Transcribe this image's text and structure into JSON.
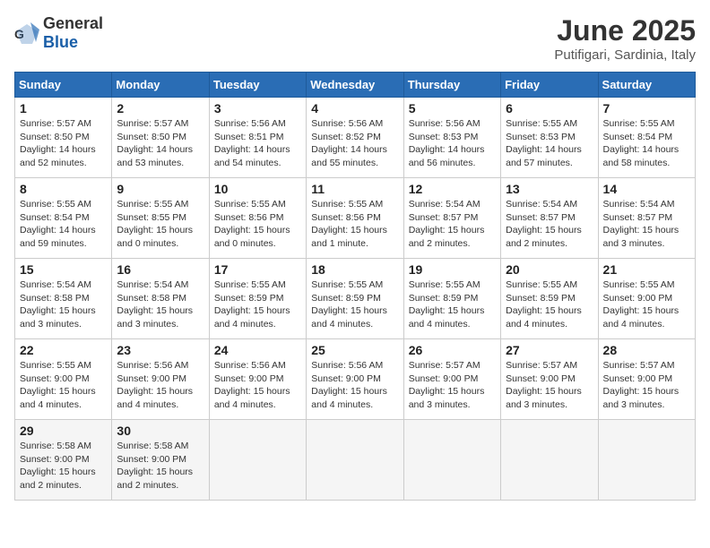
{
  "header": {
    "logo_general": "General",
    "logo_blue": "Blue",
    "month": "June 2025",
    "location": "Putifigari, Sardinia, Italy"
  },
  "days_of_week": [
    "Sunday",
    "Monday",
    "Tuesday",
    "Wednesday",
    "Thursday",
    "Friday",
    "Saturday"
  ],
  "weeks": [
    [
      {
        "day": "1",
        "sunrise": "5:57 AM",
        "sunset": "8:50 PM",
        "daylight": "14 hours and 52 minutes."
      },
      {
        "day": "2",
        "sunrise": "5:57 AM",
        "sunset": "8:50 PM",
        "daylight": "14 hours and 53 minutes."
      },
      {
        "day": "3",
        "sunrise": "5:56 AM",
        "sunset": "8:51 PM",
        "daylight": "14 hours and 54 minutes."
      },
      {
        "day": "4",
        "sunrise": "5:56 AM",
        "sunset": "8:52 PM",
        "daylight": "14 hours and 55 minutes."
      },
      {
        "day": "5",
        "sunrise": "5:56 AM",
        "sunset": "8:53 PM",
        "daylight": "14 hours and 56 minutes."
      },
      {
        "day": "6",
        "sunrise": "5:55 AM",
        "sunset": "8:53 PM",
        "daylight": "14 hours and 57 minutes."
      },
      {
        "day": "7",
        "sunrise": "5:55 AM",
        "sunset": "8:54 PM",
        "daylight": "14 hours and 58 minutes."
      }
    ],
    [
      {
        "day": "8",
        "sunrise": "5:55 AM",
        "sunset": "8:54 PM",
        "daylight": "14 hours and 59 minutes."
      },
      {
        "day": "9",
        "sunrise": "5:55 AM",
        "sunset": "8:55 PM",
        "daylight": "15 hours and 0 minutes."
      },
      {
        "day": "10",
        "sunrise": "5:55 AM",
        "sunset": "8:56 PM",
        "daylight": "15 hours and 0 minutes."
      },
      {
        "day": "11",
        "sunrise": "5:55 AM",
        "sunset": "8:56 PM",
        "daylight": "15 hours and 1 minute."
      },
      {
        "day": "12",
        "sunrise": "5:54 AM",
        "sunset": "8:57 PM",
        "daylight": "15 hours and 2 minutes."
      },
      {
        "day": "13",
        "sunrise": "5:54 AM",
        "sunset": "8:57 PM",
        "daylight": "15 hours and 2 minutes."
      },
      {
        "day": "14",
        "sunrise": "5:54 AM",
        "sunset": "8:57 PM",
        "daylight": "15 hours and 3 minutes."
      }
    ],
    [
      {
        "day": "15",
        "sunrise": "5:54 AM",
        "sunset": "8:58 PM",
        "daylight": "15 hours and 3 minutes."
      },
      {
        "day": "16",
        "sunrise": "5:54 AM",
        "sunset": "8:58 PM",
        "daylight": "15 hours and 3 minutes."
      },
      {
        "day": "17",
        "sunrise": "5:55 AM",
        "sunset": "8:59 PM",
        "daylight": "15 hours and 4 minutes."
      },
      {
        "day": "18",
        "sunrise": "5:55 AM",
        "sunset": "8:59 PM",
        "daylight": "15 hours and 4 minutes."
      },
      {
        "day": "19",
        "sunrise": "5:55 AM",
        "sunset": "8:59 PM",
        "daylight": "15 hours and 4 minutes."
      },
      {
        "day": "20",
        "sunrise": "5:55 AM",
        "sunset": "8:59 PM",
        "daylight": "15 hours and 4 minutes."
      },
      {
        "day": "21",
        "sunrise": "5:55 AM",
        "sunset": "9:00 PM",
        "daylight": "15 hours and 4 minutes."
      }
    ],
    [
      {
        "day": "22",
        "sunrise": "5:55 AM",
        "sunset": "9:00 PM",
        "daylight": "15 hours and 4 minutes."
      },
      {
        "day": "23",
        "sunrise": "5:56 AM",
        "sunset": "9:00 PM",
        "daylight": "15 hours and 4 minutes."
      },
      {
        "day": "24",
        "sunrise": "5:56 AM",
        "sunset": "9:00 PM",
        "daylight": "15 hours and 4 minutes."
      },
      {
        "day": "25",
        "sunrise": "5:56 AM",
        "sunset": "9:00 PM",
        "daylight": "15 hours and 4 minutes."
      },
      {
        "day": "26",
        "sunrise": "5:57 AM",
        "sunset": "9:00 PM",
        "daylight": "15 hours and 3 minutes."
      },
      {
        "day": "27",
        "sunrise": "5:57 AM",
        "sunset": "9:00 PM",
        "daylight": "15 hours and 3 minutes."
      },
      {
        "day": "28",
        "sunrise": "5:57 AM",
        "sunset": "9:00 PM",
        "daylight": "15 hours and 3 minutes."
      }
    ],
    [
      {
        "day": "29",
        "sunrise": "5:58 AM",
        "sunset": "9:00 PM",
        "daylight": "15 hours and 2 minutes."
      },
      {
        "day": "30",
        "sunrise": "5:58 AM",
        "sunset": "9:00 PM",
        "daylight": "15 hours and 2 minutes."
      },
      null,
      null,
      null,
      null,
      null
    ]
  ],
  "labels": {
    "sunrise": "Sunrise:",
    "sunset": "Sunset:",
    "daylight": "Daylight:"
  }
}
